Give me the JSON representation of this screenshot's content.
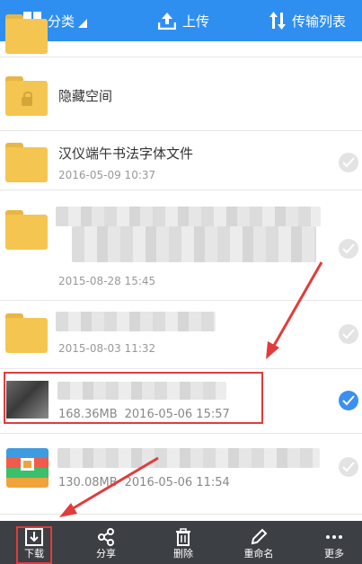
{
  "toolbar": {
    "category_label": "分类",
    "upload_label": "上传",
    "transfer_label": "传输列表"
  },
  "files": [
    {
      "name": "隐藏空间",
      "date": "",
      "size": ""
    },
    {
      "name": "汉仪端午书法字体文件",
      "date": "2016-05-09  10:37",
      "size": ""
    },
    {
      "name": "",
      "date": "2015-08-28  15:45",
      "size": ""
    },
    {
      "name": "",
      "date": "2015-08-03  11:32",
      "size": ""
    },
    {
      "name": "",
      "date": "2016-05-06  15:57",
      "size": "168.36MB"
    },
    {
      "name": "",
      "date": "2016-05-06  11:54",
      "size": "130.08MB"
    }
  ],
  "actions": {
    "download": "下载",
    "share": "分享",
    "delete": "删除",
    "rename": "重命名",
    "more": "更多"
  },
  "colors": {
    "toolbar": "#2f8ff0",
    "bottom_bar": "#3c3f44",
    "folder": "#f4c550",
    "selected_check": "#3b8ff0",
    "annotation": "#e33b3b"
  }
}
